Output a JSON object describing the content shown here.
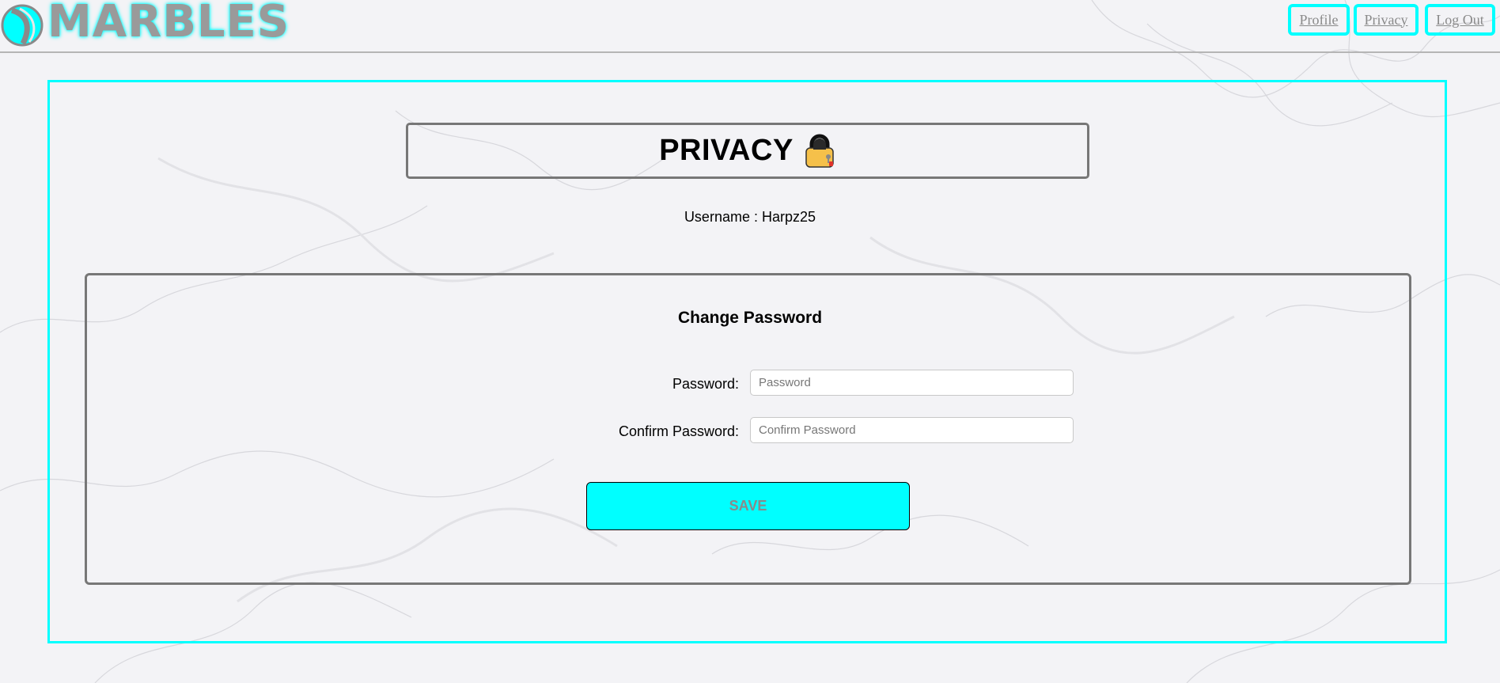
{
  "header": {
    "logo_text": "MARBLES",
    "nav": {
      "profile": "Profile",
      "privacy": "Privacy",
      "logout": "Log Out"
    }
  },
  "page": {
    "title": "PRIVACY",
    "title_icon": "lock-icon",
    "username_label": "Username :",
    "username_value": "Harpz25"
  },
  "change_password": {
    "heading": "Change Password",
    "password_label": "Password:",
    "password_placeholder": "Password",
    "password_value": "",
    "confirm_label": "Confirm Password:",
    "confirm_placeholder": "Confirm Password",
    "confirm_value": "",
    "save_label": "SAVE"
  },
  "colors": {
    "accent": "#00ffff",
    "border": "#777777",
    "nav_text": "#8a8a8a"
  }
}
